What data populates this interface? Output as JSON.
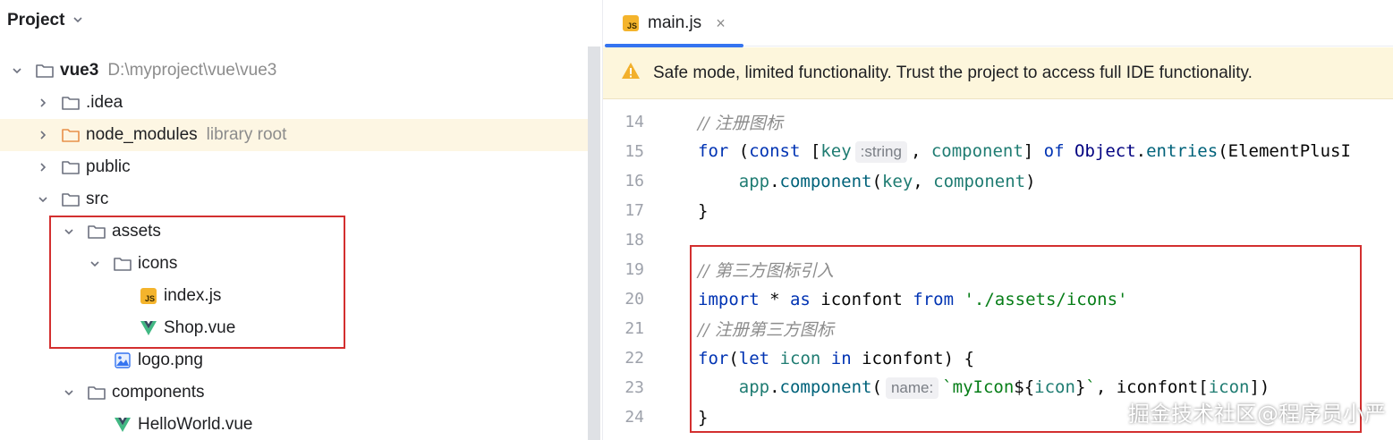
{
  "project_panel": {
    "title": "Project",
    "tree": [
      {
        "label": "vue3",
        "hint": "D:\\myproject\\vue\\vue3",
        "type": "folder",
        "expanded": true
      },
      {
        "label": ".idea",
        "type": "folder",
        "expanded": false
      },
      {
        "label": "node_modules",
        "hint": "library root",
        "type": "folder",
        "expanded": false
      },
      {
        "label": "public",
        "type": "folder",
        "expanded": false
      },
      {
        "label": "src",
        "type": "folder",
        "expanded": true
      },
      {
        "label": "assets",
        "type": "folder",
        "expanded": true
      },
      {
        "label": "icons",
        "type": "folder",
        "expanded": true
      },
      {
        "label": "index.js",
        "type": "js-file"
      },
      {
        "label": "Shop.vue",
        "type": "vue-file"
      },
      {
        "label": "logo.png",
        "type": "image-file"
      },
      {
        "label": "components",
        "type": "folder",
        "expanded": true
      },
      {
        "label": "HelloWorld.vue",
        "type": "vue-file"
      }
    ]
  },
  "editor": {
    "tab": {
      "label": "main.js",
      "icon_text": "JS",
      "close": "×"
    },
    "banner": {
      "text": "Safe mode, limited functionality. Trust the project to access full IDE functionality."
    },
    "lines": [
      {
        "num": "14",
        "tokens": [
          {
            "t": "cm",
            "v": "// 注册图标"
          }
        ]
      },
      {
        "num": "15",
        "tokens": [
          {
            "t": "kw",
            "v": "for"
          },
          {
            "t": "pl",
            "v": " ("
          },
          {
            "t": "kw",
            "v": "const"
          },
          {
            "t": "pl",
            "v": " ["
          },
          {
            "t": "vr",
            "v": "key"
          },
          {
            "t": "hint",
            "v": ":string"
          },
          {
            "t": "pl",
            "v": ", "
          },
          {
            "t": "vr",
            "v": "component"
          },
          {
            "t": "pl",
            "v": "] "
          },
          {
            "t": "kw",
            "v": "of"
          },
          {
            "t": "pl",
            "v": " "
          },
          {
            "t": "cls",
            "v": "Object"
          },
          {
            "t": "pl",
            "v": "."
          },
          {
            "t": "fn",
            "v": "entries"
          },
          {
            "t": "pl",
            "v": "(ElementPlusI"
          }
        ]
      },
      {
        "num": "16",
        "tokens": [
          {
            "t": "pl",
            "v": "    "
          },
          {
            "t": "vr",
            "v": "app"
          },
          {
            "t": "pl",
            "v": "."
          },
          {
            "t": "fn",
            "v": "component"
          },
          {
            "t": "pl",
            "v": "("
          },
          {
            "t": "vr",
            "v": "key"
          },
          {
            "t": "pl",
            "v": ", "
          },
          {
            "t": "vr",
            "v": "component"
          },
          {
            "t": "pl",
            "v": ")"
          }
        ]
      },
      {
        "num": "17",
        "tokens": [
          {
            "t": "pl",
            "v": "}"
          }
        ]
      },
      {
        "num": "18",
        "tokens": []
      },
      {
        "num": "19",
        "tokens": [
          {
            "t": "cm",
            "v": "// 第三方图标引入"
          }
        ]
      },
      {
        "num": "20",
        "tokens": [
          {
            "t": "kw",
            "v": "import"
          },
          {
            "t": "pl",
            "v": " * "
          },
          {
            "t": "kw",
            "v": "as"
          },
          {
            "t": "pl",
            "v": " iconfont "
          },
          {
            "t": "kw",
            "v": "from"
          },
          {
            "t": "pl",
            "v": " "
          },
          {
            "t": "str",
            "v": "'./assets/icons'"
          }
        ]
      },
      {
        "num": "21",
        "tokens": [
          {
            "t": "cm",
            "v": "// 注册第三方图标"
          }
        ]
      },
      {
        "num": "22",
        "tokens": [
          {
            "t": "kw",
            "v": "for"
          },
          {
            "t": "pl",
            "v": "("
          },
          {
            "t": "kw",
            "v": "let"
          },
          {
            "t": "pl",
            "v": " "
          },
          {
            "t": "vr",
            "v": "icon"
          },
          {
            "t": "pl",
            "v": " "
          },
          {
            "t": "kw",
            "v": "in"
          },
          {
            "t": "pl",
            "v": " iconfont) {"
          }
        ]
      },
      {
        "num": "23",
        "tokens": [
          {
            "t": "pl",
            "v": "    "
          },
          {
            "t": "vr",
            "v": "app"
          },
          {
            "t": "pl",
            "v": "."
          },
          {
            "t": "fn",
            "v": "component"
          },
          {
            "t": "pl",
            "v": "("
          },
          {
            "t": "hint",
            "v": "name:"
          },
          {
            "t": "str",
            "v": "`myIcon"
          },
          {
            "t": "pl",
            "v": "${"
          },
          {
            "t": "vr",
            "v": "icon"
          },
          {
            "t": "pl",
            "v": "}"
          },
          {
            "t": "str",
            "v": "`"
          },
          {
            "t": "pl",
            "v": ", iconfont["
          },
          {
            "t": "vr",
            "v": "icon"
          },
          {
            "t": "pl",
            "v": "])"
          }
        ]
      },
      {
        "num": "24",
        "tokens": [
          {
            "t": "pl",
            "v": "}"
          }
        ]
      }
    ]
  },
  "watermark": "掘金技术社区@程序员小严",
  "colors": {
    "accent": "#3574f0",
    "highlight_box": "#d32f2f",
    "banner_bg": "#fdf6dc",
    "warning": "#f2b02c"
  }
}
